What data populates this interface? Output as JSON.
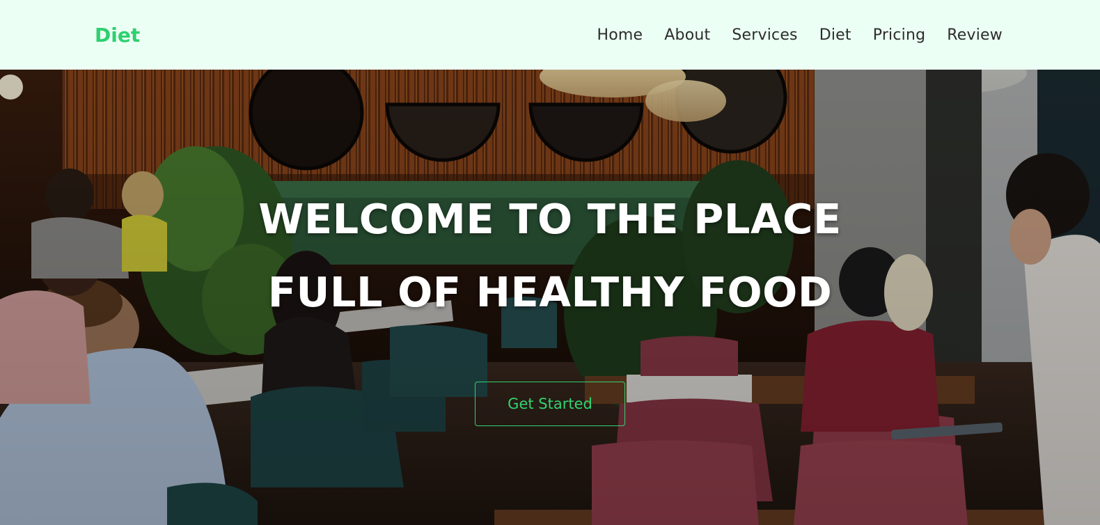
{
  "navbar": {
    "brand": "Diet",
    "links": [
      {
        "label": "Home"
      },
      {
        "label": "About"
      },
      {
        "label": "Services"
      },
      {
        "label": "Diet"
      },
      {
        "label": "Pricing"
      },
      {
        "label": "Review"
      }
    ]
  },
  "hero": {
    "title_line_1": "WELCOME TO THE PLACE",
    "title_line_2": "FULL OF HEALTHY FOOD",
    "cta_label": "Get Started",
    "background_image": "restaurant-interior-photo"
  },
  "colors": {
    "accent": "#2fd06f",
    "navbar_bg": "#ecfff4",
    "nav_text": "#2c2c2c",
    "hero_text": "#ffffff"
  }
}
